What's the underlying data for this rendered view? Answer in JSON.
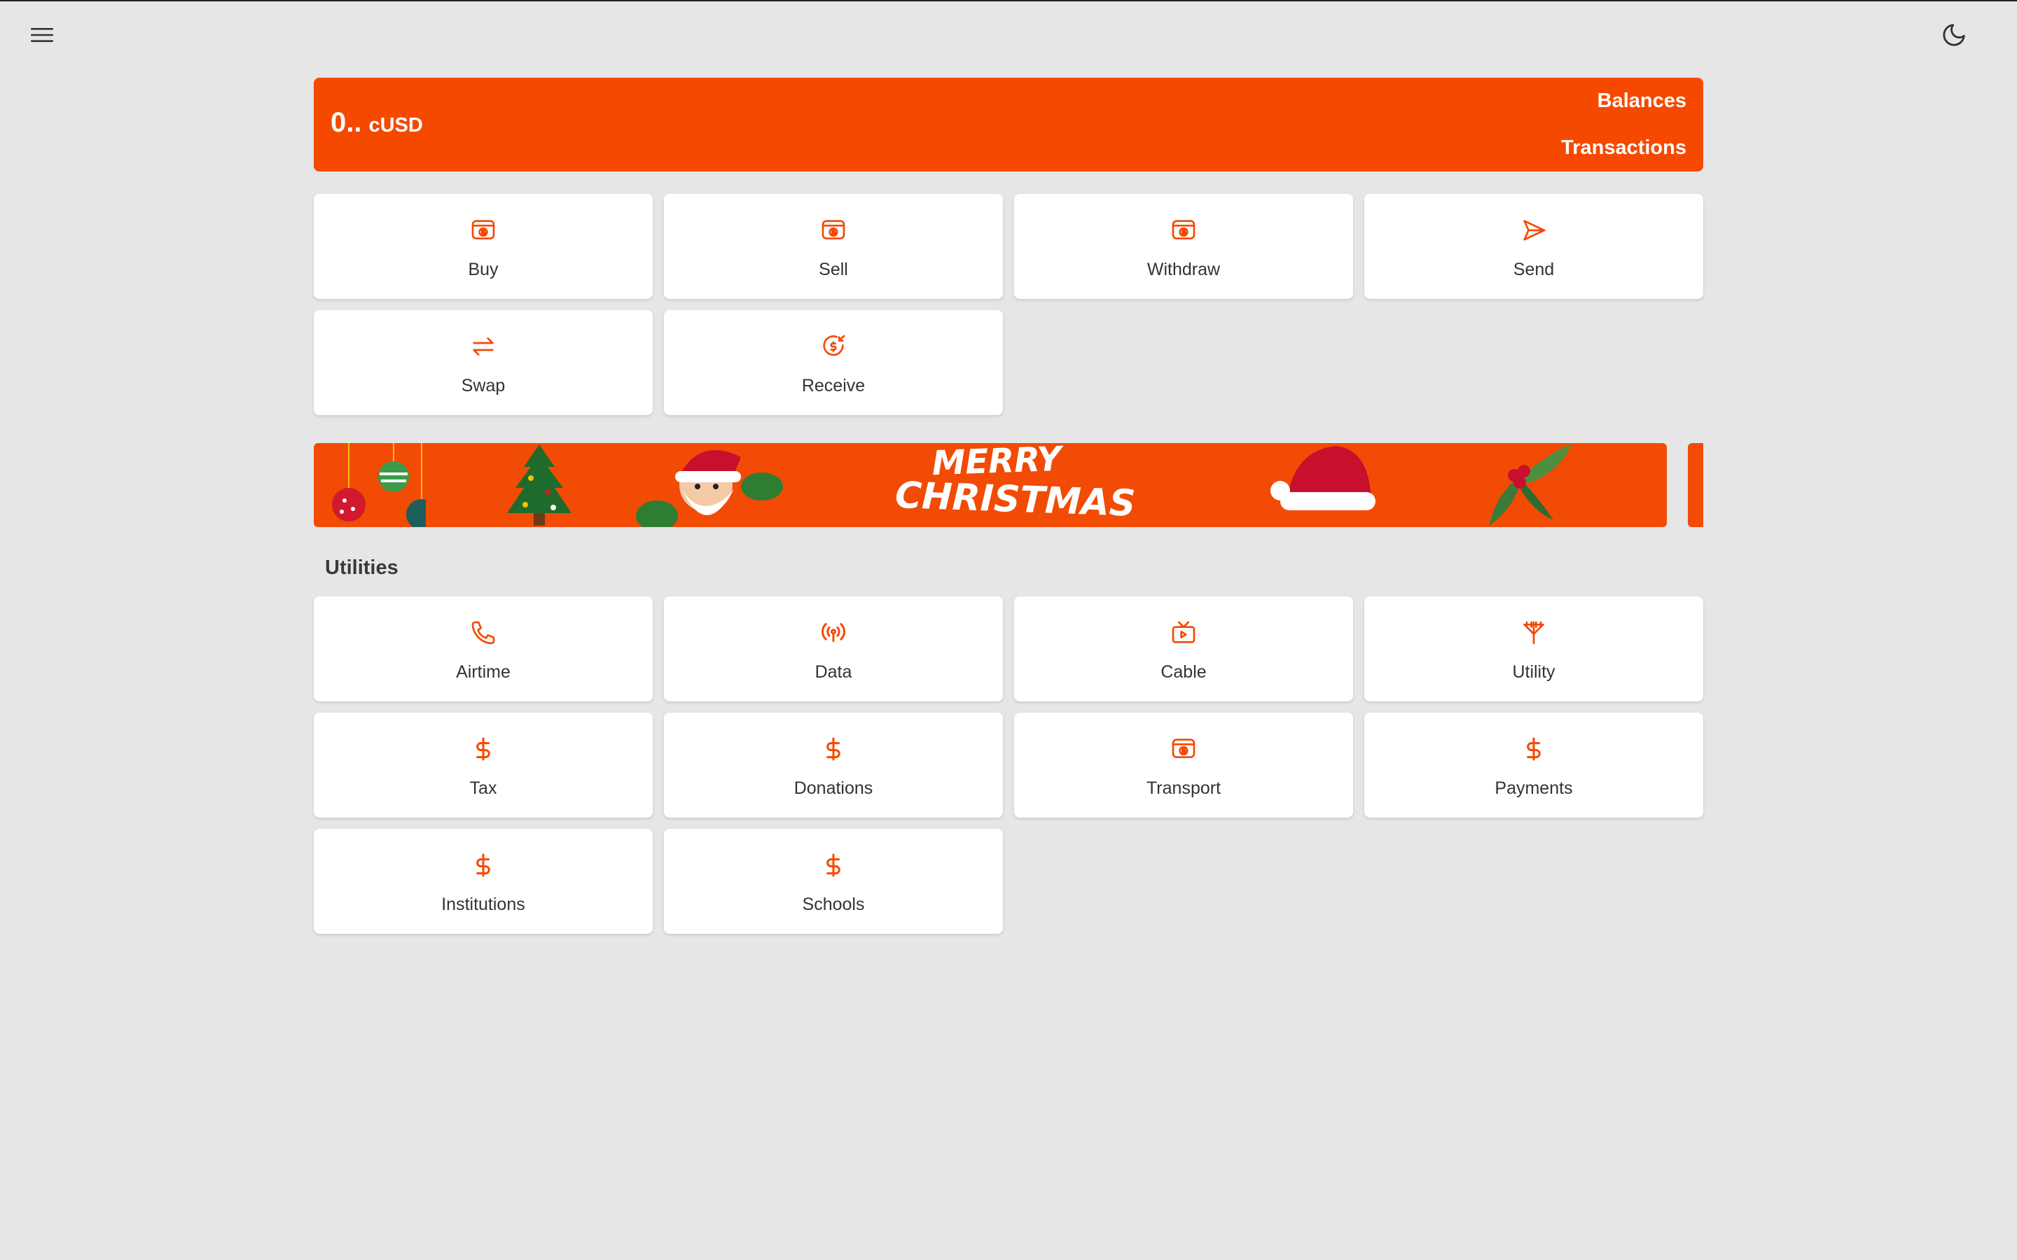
{
  "header": {
    "menu_icon": "hamburger-menu-icon",
    "theme_icon": "moon-icon"
  },
  "balance": {
    "amount": "0..",
    "currency": "cUSD",
    "balances_label": "Balances",
    "transactions_label": "Transactions",
    "accent_color": "#f54900"
  },
  "actions": [
    {
      "label": "Buy",
      "icon": "bitcoin-atm-icon"
    },
    {
      "label": "Sell",
      "icon": "bitcoin-atm-icon"
    },
    {
      "label": "Withdraw",
      "icon": "bitcoin-atm-icon"
    },
    {
      "label": "Send",
      "icon": "send-icon"
    },
    {
      "label": "Swap",
      "icon": "swap-arrows-icon"
    },
    {
      "label": "Receive",
      "icon": "receive-dollar-icon"
    }
  ],
  "banner": {
    "line1": "MERRY",
    "line2": "CHRISTMAS"
  },
  "utilities": {
    "title": "Utilities",
    "items": [
      {
        "label": "Airtime",
        "icon": "phone-icon"
      },
      {
        "label": "Data",
        "icon": "broadcast-signal-icon"
      },
      {
        "label": "Cable",
        "icon": "tv-icon"
      },
      {
        "label": "Utility",
        "icon": "power-pole-icon"
      },
      {
        "label": "Tax",
        "icon": "dollar-icon"
      },
      {
        "label": "Donations",
        "icon": "dollar-icon"
      },
      {
        "label": "Transport",
        "icon": "bitcoin-atm-icon"
      },
      {
        "label": "Payments",
        "icon": "dollar-icon"
      },
      {
        "label": "Institutions",
        "icon": "dollar-icon"
      },
      {
        "label": "Schools",
        "icon": "dollar-icon"
      }
    ]
  }
}
